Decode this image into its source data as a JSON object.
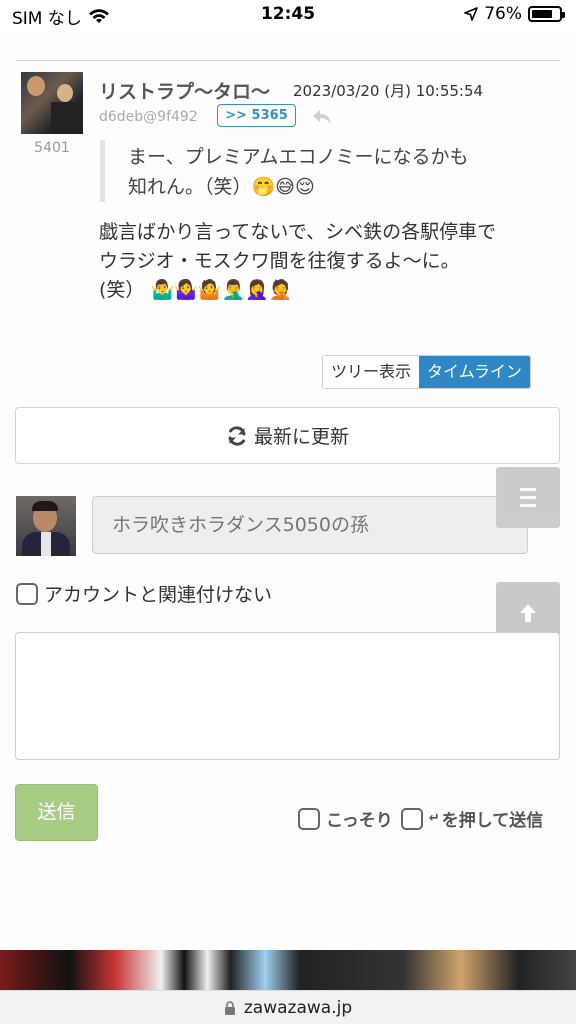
{
  "status_bar": {
    "carrier": "SIM なし",
    "time": "12:45",
    "battery": "76%",
    "battery_level": 0.76
  },
  "post": {
    "number": "5401",
    "author": "リストラプ〜タロ〜",
    "date": "2023/03/20 (月) 10:55:54",
    "user_id": "d6deb@9f492",
    "reply_ref": ">> 5365",
    "quote_line1": "まー、プレミアムエコノミーになるかも",
    "quote_line2": "知れん。（笑）",
    "quote_emoji": "🤭😅😌",
    "body_line1": "戯言ばかり言ってないで、シベ鉄の各駅停車で",
    "body_line2": "ウラジオ・モスクワ間を往復するよ〜に。",
    "body_line3": "(笑）",
    "body_emoji": "🤷‍♂️🤷‍♀️🤷🤦‍♂️🤦‍♀️🤦"
  },
  "view_toggle": {
    "tree_label": "ツリー表示",
    "timeline_label": "タイムライン"
  },
  "refresh": {
    "label": "最新に更新"
  },
  "form": {
    "name_placeholder": "ホラ吹きホラダンス5050の孫",
    "anon_label": "アカウントと関連付けない",
    "send_label": "送信",
    "secret_label": "こっそり",
    "enter_label": "を押して送信"
  },
  "browser": {
    "url": "zawazawa.jp"
  }
}
